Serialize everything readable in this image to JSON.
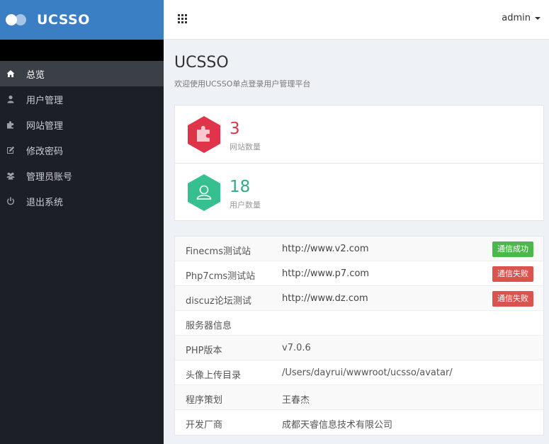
{
  "brand": {
    "name": "UCSSO"
  },
  "header": {
    "user": "admin",
    "apps_icon": "grid-icon"
  },
  "sidebar": {
    "items": [
      {
        "label": "总览",
        "icon": "home-icon",
        "active": true
      },
      {
        "label": "用户管理",
        "icon": "user-icon",
        "active": false
      },
      {
        "label": "网站管理",
        "icon": "puzzle-icon",
        "active": false
      },
      {
        "label": "修改密码",
        "icon": "edit-icon",
        "active": false
      },
      {
        "label": "管理员账号",
        "icon": "users-icon",
        "active": false
      },
      {
        "label": "退出系统",
        "icon": "power-icon",
        "active": false
      }
    ]
  },
  "page": {
    "title": "UCSSO",
    "subtitle": "欢迎使用UCSSO单点登录用户管理平台"
  },
  "stats": [
    {
      "value": "3",
      "label": "网站数量",
      "color": "#e0344a",
      "icon": "puzzle-icon"
    },
    {
      "value": "18",
      "label": "用户数量",
      "color": "#36c08f",
      "icon": "user-icon"
    }
  ],
  "sites": [
    {
      "name": "Finecms测试站",
      "url": "http://www.v2.com",
      "status": "通信成功",
      "status_color": "#4cb84c"
    },
    {
      "name": "Php7cms测试站",
      "url": "http://www.p7.com",
      "status": "通信失败",
      "status_color": "#d9534f"
    },
    {
      "name": "discuz论坛测试",
      "url": "http://www.dz.com",
      "status": "通信失败",
      "status_color": "#d9534f"
    }
  ],
  "server": {
    "heading": "服务器信息",
    "rows": [
      {
        "name": "PHP版本",
        "value": "v7.0.6"
      },
      {
        "name": "头像上传目录",
        "value": "/Users/dayrui/wwwroot/ucsso/avatar/"
      },
      {
        "name": "程序策划",
        "value": "王春杰"
      },
      {
        "name": "开发厂商",
        "value": "成都天睿信息技术有限公司"
      }
    ]
  },
  "colors": {
    "brand_bar": "#3a7ec4",
    "sidebar": "#1c1f26",
    "active_item": "#3b3f46"
  }
}
